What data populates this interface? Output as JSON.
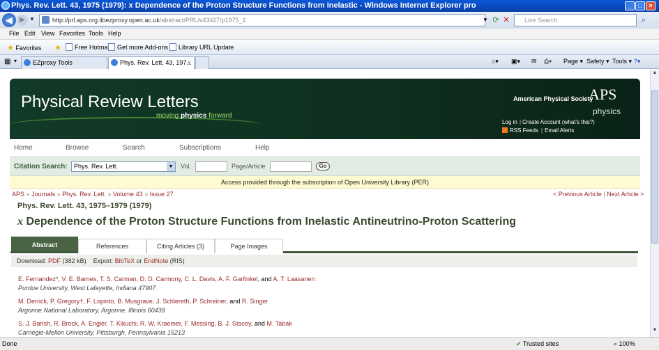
{
  "window": {
    "title": "Phys. Rev. Lett. 43, 1975 (1979): x Dependence of the Proton Structure Functions from Inelastic - Windows Internet Explorer pro"
  },
  "address": {
    "url_host": "http://prl.aps.org.libezproxy.open.ac.uk",
    "url_path": "/abstract/PRL/v43/i27/p1975_1",
    "search_placeholder": "Live Search"
  },
  "menu": [
    "File",
    "Edit",
    "View",
    "Favorites",
    "Tools",
    "Help"
  ],
  "favorites": {
    "label": "Favorites",
    "items": [
      "Free Hotmail",
      "Get more Add-ons ▾",
      "Library URL Update"
    ]
  },
  "tabs": [
    {
      "label": "EZproxy Tools"
    },
    {
      "label": "Phys. Rev. Lett. 43, 197..."
    }
  ],
  "commands": [
    "Page ▾",
    "Safety ▾",
    "Tools ▾"
  ],
  "site": {
    "title": "Physical Review Letters",
    "tagline_pre": "moving",
    "tagline_bold": "physics",
    "tagline_post": "forward",
    "aps_name": "American Physical Society",
    "aps_logo": "APS",
    "aps_logo_sub": "physics",
    "login": "Log in",
    "create": "Create Account (what's this?)",
    "rss": "RSS Feeds",
    "alerts": "Email Alerts"
  },
  "nav": [
    "Home",
    "Browse",
    "Search",
    "Subscriptions",
    "Help"
  ],
  "citation": {
    "label": "Citation Search:",
    "journal": "Phys. Rev. Lett.",
    "vol_label": "Vol.",
    "page_label": "Page/Article",
    "go": "Go"
  },
  "access": "Access provided through the subscription of Open University Library (PER)",
  "breadcrumb": [
    "APS",
    "Journals",
    "Phys. Rev. Lett.",
    "Volume 43",
    "Issue 27"
  ],
  "prev": "< Previous Article",
  "next": "Next Article >",
  "article": {
    "citation": "Phys. Rev. Lett. 43, 1975–1979 (1979)",
    "title_var": "x",
    "title_rest": "Dependence of the Proton Structure Functions from Inelastic Antineutrino-Proton Scattering"
  },
  "article_tabs": [
    "Abstract",
    "References",
    "Citing Articles (3)",
    "Page Images"
  ],
  "download": {
    "label": "Download:",
    "pdf": "PDF",
    "pdf_size": "(382 kB)",
    "export_label": "Export:",
    "bibtex": "BibTeX",
    "or": "or",
    "endnote": "EndNote",
    "endnote_fmt": "(RIS)"
  },
  "author_groups": [
    {
      "authors": "E. Fernandez*, V. E. Barnes, T. S. Carman, D. D. Carmony, C. L. Davis, A. F. Garfinkel,",
      "and_text": "and",
      "last": "A. T. Laasanen",
      "affiliation": "Purdue University, West Lafayette, Indiana 47907"
    },
    {
      "authors": "M. Derrick, P. Gregory†, F. Lopinto, B. Musgrave, J. Schlereth, P. Schreiner,",
      "and_text": "and",
      "last": "R. Singer",
      "affiliation": "Argonne National Laboratory, Argonne, Illinois 60439"
    },
    {
      "authors": "S. J. Barish, R. Brock, A. Engler, T. Kikuchi, R. W. Kraemer, F. Messing, B. J. Stacey,",
      "and_text": "and",
      "last": "M. Tabak",
      "affiliation": "Carnegie-Mellon University, Pittsburgh, Pennsylvania 15213"
    }
  ],
  "status": {
    "left": "Done",
    "zone": "Trusted sites",
    "zoom": "100%"
  }
}
